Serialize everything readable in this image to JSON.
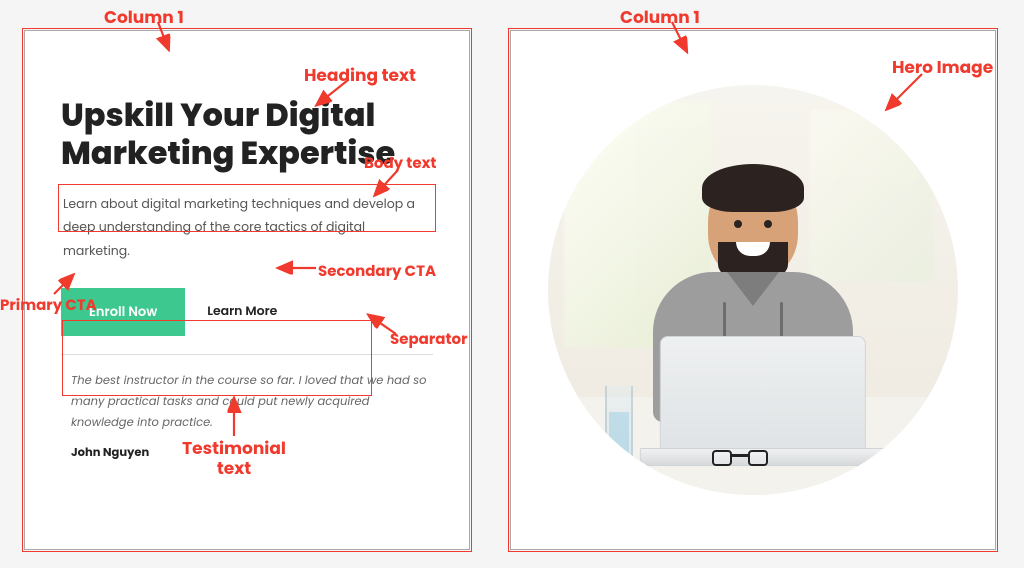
{
  "annotations": {
    "column1_left": "Column 1",
    "column1_right": "Column 1",
    "heading_text": "Heading text",
    "body_text": "Body text",
    "primary_cta": "Primary CTA",
    "secondary_cta": "Secondary CTA",
    "separator": "Separator",
    "testimonial_text": "Testimonial text",
    "hero_image": "Hero Image"
  },
  "left": {
    "heading": "Upskill Your Digital Marketing Expertise",
    "body": "Learn about digital marketing techniques and develop a deep understanding of the core tactics of digital marketing.",
    "primary_cta": "Enroll Now",
    "secondary_cta": "Learn More",
    "testimonial_quote": "The best instructor in the course so far. I loved that we had so many practical tasks and could put newly acquired knowledge into practice.",
    "testimonial_author": "John Nguyen"
  },
  "right": {
    "hero_alt": "Smiling bearded man in grey hoodie at a laptop"
  },
  "colors": {
    "annotation": "#f03a2e",
    "primary_button": "#3cc88f"
  }
}
